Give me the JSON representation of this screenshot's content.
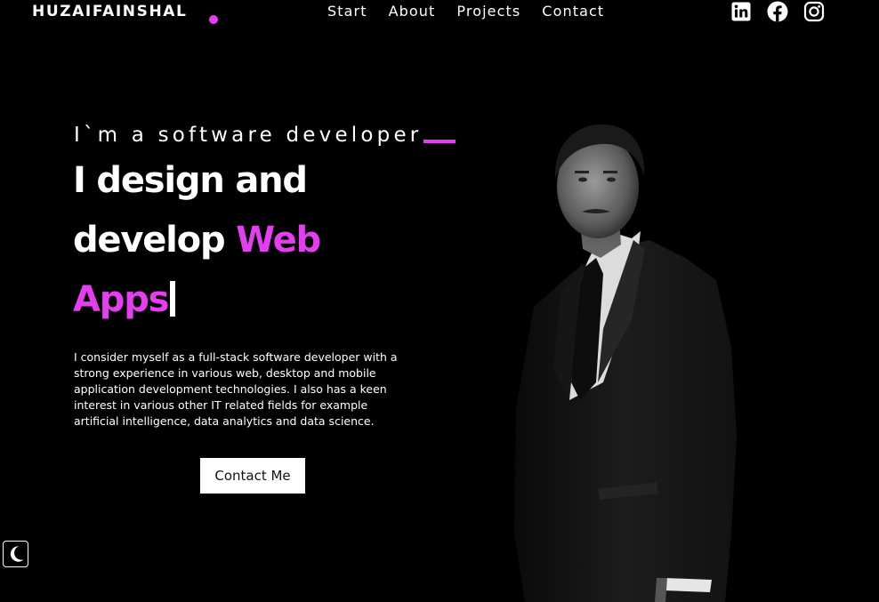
{
  "header": {
    "logo_text": "HUZAIFAINSHAL",
    "nav": [
      {
        "label": "Start"
      },
      {
        "label": "About"
      },
      {
        "label": "Projects"
      },
      {
        "label": "Contact"
      }
    ],
    "social_icons": [
      "linkedin-icon",
      "facebook-icon",
      "instagram-icon"
    ]
  },
  "hero": {
    "intro": "I`m a software developer",
    "headline_line1": "I design and",
    "headline_line2_plain": "develop ",
    "headline_line2_accent": "Web",
    "headline_line3_accent": "Apps",
    "description": "I consider myself as a full-stack software developer with a strong experience in various web, desktop and mobile application development technologies. I also has a keen interest in various other IT related fields for example artificial intelligence, data analytics and data science.",
    "cta_label": "Contact Me"
  },
  "theme_toggle_icon": "moon-icon",
  "colors": {
    "background": "#000000",
    "accent": "#e53ef0",
    "text": "#ffffff"
  }
}
